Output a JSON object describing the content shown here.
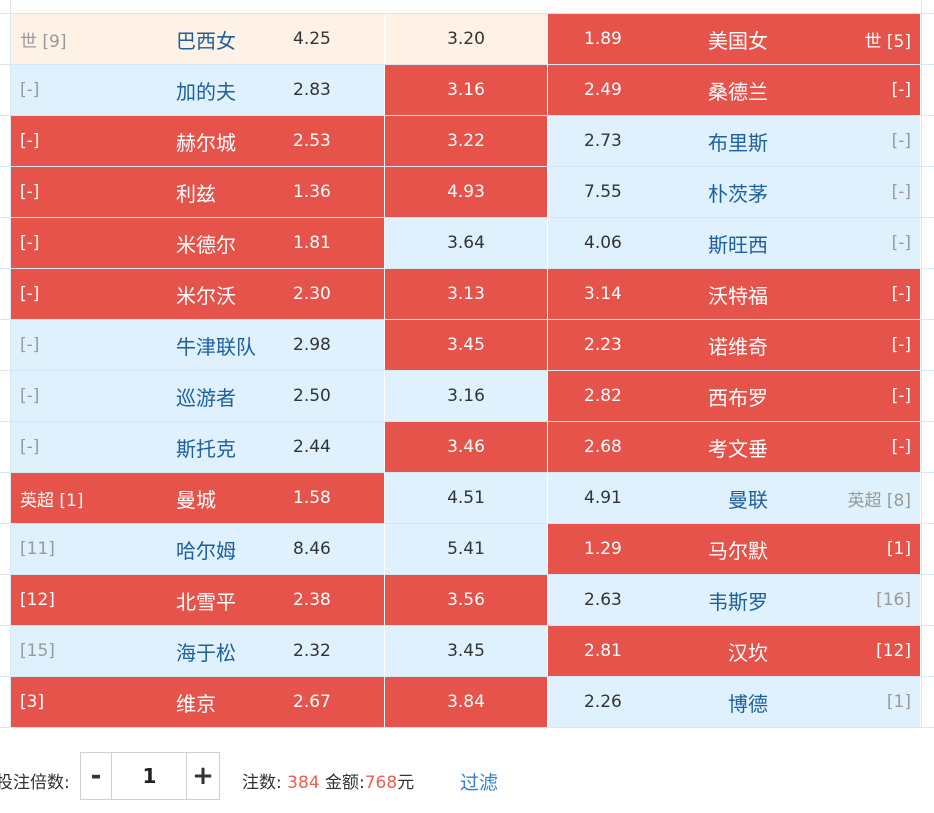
{
  "matches": [
    {
      "home_rank": "世 [9]",
      "home": "巴西女",
      "home_odd": "4.25",
      "draw_odd": "3.20",
      "away_odd": "1.89",
      "away": "美国女",
      "away_rank": "世 [5]",
      "home_sel": "peach",
      "draw_sel": "peach",
      "away_sel": "red"
    },
    {
      "home_rank": "[-]",
      "home": "加的夫",
      "home_odd": "2.83",
      "draw_odd": "3.16",
      "away_odd": "2.49",
      "away": "桑德兰",
      "away_rank": "[-]",
      "home_sel": "blue",
      "draw_sel": "red",
      "away_sel": "red"
    },
    {
      "home_rank": "[-]",
      "home": "赫尔城",
      "home_odd": "2.53",
      "draw_odd": "3.22",
      "away_odd": "2.73",
      "away": "布里斯",
      "away_rank": "[-]",
      "home_sel": "red",
      "draw_sel": "red",
      "away_sel": "blue"
    },
    {
      "home_rank": "[-]",
      "home": "利兹",
      "home_odd": "1.36",
      "draw_odd": "4.93",
      "away_odd": "7.55",
      "away": "朴茨茅",
      "away_rank": "[-]",
      "home_sel": "red",
      "draw_sel": "red",
      "away_sel": "blue"
    },
    {
      "home_rank": "[-]",
      "home": "米德尔",
      "home_odd": "1.81",
      "draw_odd": "3.64",
      "away_odd": "4.06",
      "away": "斯旺西",
      "away_rank": "[-]",
      "home_sel": "red",
      "draw_sel": "blue",
      "away_sel": "blue"
    },
    {
      "home_rank": "[-]",
      "home": "米尔沃",
      "home_odd": "2.30",
      "draw_odd": "3.13",
      "away_odd": "3.14",
      "away": "沃特福",
      "away_rank": "[-]",
      "home_sel": "red",
      "draw_sel": "red",
      "away_sel": "red"
    },
    {
      "home_rank": "[-]",
      "home": "牛津联队",
      "home_odd": "2.98",
      "draw_odd": "3.45",
      "away_odd": "2.23",
      "away": "诺维奇",
      "away_rank": "[-]",
      "home_sel": "blue",
      "draw_sel": "red",
      "away_sel": "red"
    },
    {
      "home_rank": "[-]",
      "home": "巡游者",
      "home_odd": "2.50",
      "draw_odd": "3.16",
      "away_odd": "2.82",
      "away": "西布罗",
      "away_rank": "[-]",
      "home_sel": "blue",
      "draw_sel": "blue",
      "away_sel": "red"
    },
    {
      "home_rank": "[-]",
      "home": "斯托克",
      "home_odd": "2.44",
      "draw_odd": "3.46",
      "away_odd": "2.68",
      "away": "考文垂",
      "away_rank": "[-]",
      "home_sel": "blue",
      "draw_sel": "red",
      "away_sel": "red"
    },
    {
      "home_rank": "英超 [1]",
      "home": "曼城",
      "home_odd": "1.58",
      "draw_odd": "4.51",
      "away_odd": "4.91",
      "away": "曼联",
      "away_rank": "英超 [8]",
      "home_sel": "red",
      "draw_sel": "blue",
      "away_sel": "blue"
    },
    {
      "home_rank": "[11]",
      "home": "哈尔姆",
      "home_odd": "8.46",
      "draw_odd": "5.41",
      "away_odd": "1.29",
      "away": "马尔默",
      "away_rank": "[1]",
      "home_sel": "blue",
      "draw_sel": "blue",
      "away_sel": "red"
    },
    {
      "home_rank": "[12]",
      "home": "北雪平",
      "home_odd": "2.38",
      "draw_odd": "3.56",
      "away_odd": "2.63",
      "away": "韦斯罗",
      "away_rank": "[16]",
      "home_sel": "red",
      "draw_sel": "red",
      "away_sel": "blue"
    },
    {
      "home_rank": "[15]",
      "home": "海于松",
      "home_odd": "2.32",
      "draw_odd": "3.45",
      "away_odd": "2.81",
      "away": "汉坎",
      "away_rank": "[12]",
      "home_sel": "blue",
      "draw_sel": "blue",
      "away_sel": "red"
    },
    {
      "home_rank": "[3]",
      "home": "维京",
      "home_odd": "2.67",
      "draw_odd": "3.84",
      "away_odd": "2.26",
      "away": "博德",
      "away_rank": "[1]",
      "home_sel": "red",
      "draw_sel": "red",
      "away_sel": "blue"
    }
  ],
  "footer": {
    "multiplier_label": "投注倍数:",
    "minus": "-",
    "plus": "+",
    "multiplier_value": "1",
    "bets_label": "注数:",
    "bets_value": "384",
    "amount_label": "金额:",
    "amount_value": "768",
    "amount_unit": "元",
    "filter_label": "过滤"
  },
  "colors": {
    "selected": "#e5534b",
    "unselected": "#dff1fd",
    "highlight_row": "#fef1e6",
    "accent_text": "#e8604f",
    "link": "#2f7fd0"
  }
}
